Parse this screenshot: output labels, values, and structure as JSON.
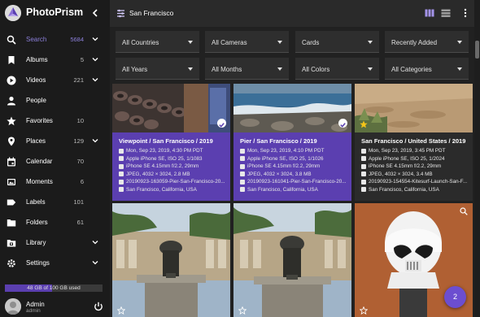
{
  "app": {
    "title": "PhotoPrism"
  },
  "sidebar": {
    "items": [
      {
        "label": "Search",
        "count": "5684",
        "icon": "search-icon",
        "active": true,
        "chevron": true
      },
      {
        "label": "Albums",
        "count": "5",
        "icon": "bookmark-icon",
        "active": false,
        "chevron": true
      },
      {
        "label": "Videos",
        "count": "221",
        "icon": "play-circle-icon",
        "active": false,
        "chevron": true
      },
      {
        "label": "People",
        "count": "",
        "icon": "person-icon",
        "active": false,
        "chevron": false
      },
      {
        "label": "Favorites",
        "count": "10",
        "icon": "star-icon",
        "active": false,
        "chevron": false
      },
      {
        "label": "Places",
        "count": "129",
        "icon": "place-icon",
        "active": false,
        "chevron": true
      },
      {
        "label": "Calendar",
        "count": "70",
        "icon": "calendar-icon",
        "active": false,
        "chevron": false
      },
      {
        "label": "Moments",
        "count": "6",
        "icon": "moments-icon",
        "active": false,
        "chevron": false
      },
      {
        "label": "Labels",
        "count": "101",
        "icon": "label-icon",
        "active": false,
        "chevron": false
      },
      {
        "label": "Folders",
        "count": "61",
        "icon": "folder-icon",
        "active": false,
        "chevron": false
      },
      {
        "label": "Library",
        "count": "",
        "icon": "library-icon",
        "active": false,
        "chevron": true
      },
      {
        "label": "Settings",
        "count": "",
        "icon": "gear-icon",
        "active": false,
        "chevron": true
      }
    ],
    "storage": {
      "text": "48 GB of 100 GB used",
      "fraction": 0.48
    },
    "user": {
      "name": "Admin",
      "role": "admin"
    }
  },
  "topbar": {
    "search_value": "San Francisco"
  },
  "filters": {
    "row1": [
      "All Countries",
      "All Cameras",
      "Cards",
      "Recently Added"
    ],
    "row2": [
      "All Years",
      "All Months",
      "All Colors",
      "All Categories"
    ]
  },
  "cards": [
    {
      "title": "Viewpoint / San Francisco / 2019",
      "lines": [
        "Mon, Sep 23, 2019, 4:30 PM PDT",
        "Apple iPhone SE, ISO 25, 1/1083",
        "iPhone SE 4.15mm f/2.2, 29mm",
        "JPEG, 4032 × 3024, 2.8 MB",
        "20190923-163059-Pier-San-Francisco-20...",
        "San Francisco, California, USA"
      ],
      "selected": true,
      "favorite": false
    },
    {
      "title": "Pier / San Francisco / 2019",
      "lines": [
        "Mon, Sep 23, 2019, 4:10 PM PDT",
        "Apple iPhone SE, ISO 25, 1/1026",
        "iPhone SE 4.15mm f/2.2, 29mm",
        "JPEG, 4032 × 3024, 3.8 MB",
        "20190923-161041-Pier-San-Francisco-20...",
        "San Francisco, California, USA"
      ],
      "selected": true,
      "favorite": false
    },
    {
      "title": "San Francisco / United States / 2019",
      "lines": [
        "Mon, Sep 23, 2019, 3:45 PM PDT",
        "Apple iPhone SE, ISO 25, 1/2024",
        "iPhone SE 4.15mm f/2.2, 29mm",
        "JPEG, 4032 × 3024, 3.4 MB",
        "20190923-154554-Kitesurf-Launch-San-F...",
        "San Francisco, California, USA"
      ],
      "selected": false,
      "favorite": true
    }
  ],
  "selection": {
    "count": "2"
  },
  "colors": {
    "accent": "#6c4ed0",
    "selected_card": "#5b3fb0",
    "card": "#2b2b2b"
  }
}
